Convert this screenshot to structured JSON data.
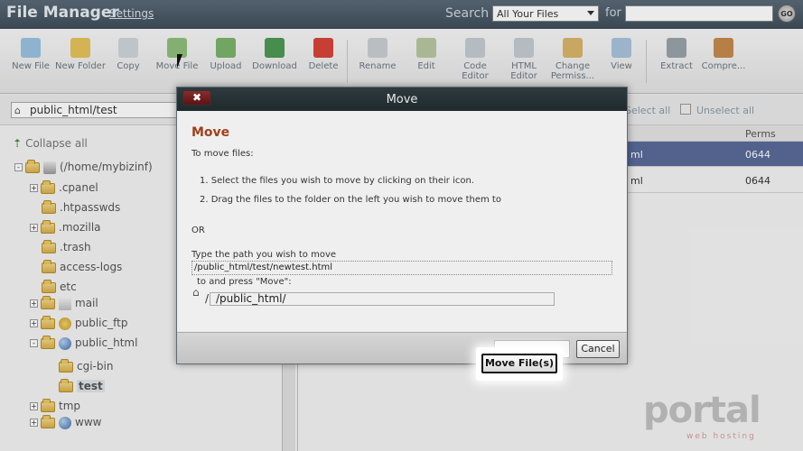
{
  "header": {
    "title": "File Manager",
    "settings_label": "Settings",
    "search_label": "Search",
    "search_scope": "All Your Files",
    "for_label": "for",
    "search_value": "",
    "go_label": "GO"
  },
  "toolbar": {
    "tools": [
      {
        "label": "New File",
        "icon": "new-file-icon",
        "color": "#9bc3e0"
      },
      {
        "label": "New Folder",
        "icon": "new-folder-icon",
        "color": "#e6c35a"
      },
      {
        "label": "Copy",
        "icon": "copy-icon",
        "color": "#cfd6dc"
      },
      {
        "label": "Move File",
        "icon": "move-file-icon",
        "color": "#8fbf7a"
      },
      {
        "label": "Upload",
        "icon": "upload-icon",
        "color": "#7ab36b"
      },
      {
        "label": "Download",
        "icon": "download-icon",
        "color": "#4d9a55"
      },
      {
        "label": "Delete",
        "icon": "delete-icon",
        "color": "#d8443a"
      },
      {
        "label": "Rename",
        "icon": "rename-icon",
        "color": "#c9cfd4"
      },
      {
        "label": "Edit",
        "icon": "edit-icon",
        "color": "#b9c7a2"
      },
      {
        "label": "Code Editor",
        "icon": "code-editor-icon",
        "color": "#c4ccd3"
      },
      {
        "label": "HTML Editor",
        "icon": "html-editor-icon",
        "color": "#c4ccd3"
      },
      {
        "label": "Change Permiss...",
        "icon": "key-icon",
        "color": "#d9b66a"
      },
      {
        "label": "View",
        "icon": "view-icon",
        "color": "#a9c4dc"
      },
      {
        "label": "Extract",
        "icon": "extract-icon",
        "color": "#9aa3aa"
      },
      {
        "label": "Compre...",
        "icon": "compress-icon",
        "color": "#c68a4b"
      }
    ]
  },
  "pathbar": {
    "path": "public_html/test"
  },
  "sidebar": {
    "collapse_label": "Collapse all",
    "tree": [
      {
        "label": "(/home/mybizinf)",
        "type": "home"
      },
      {
        "label": ".cpanel",
        "type": "folder"
      },
      {
        "label": ".htpasswds",
        "type": "folder"
      },
      {
        "label": ".mozilla",
        "type": "folder"
      },
      {
        "label": ".trash",
        "type": "folder"
      },
      {
        "label": "access-logs",
        "type": "folder"
      },
      {
        "label": "etc",
        "type": "folder"
      },
      {
        "label": "mail",
        "type": "mail"
      },
      {
        "label": "public_ftp",
        "type": "ftp"
      },
      {
        "label": "public_html",
        "type": "globe"
      },
      {
        "label": "cgi-bin",
        "type": "folder"
      },
      {
        "label": "test",
        "type": "folder-selected"
      },
      {
        "label": "tmp",
        "type": "folder"
      },
      {
        "label": "www",
        "type": "globe"
      }
    ]
  },
  "filepanel": {
    "select_all": "Select all",
    "unselect_all": "Unselect all",
    "perms_header": "Perms",
    "rows": [
      {
        "name": "ml",
        "perms": "0644",
        "selected": true
      },
      {
        "name": "ml",
        "perms": "0644",
        "selected": false
      }
    ]
  },
  "modal": {
    "title": "Move",
    "close_label": "✖",
    "heading": "Move",
    "intro": "To move files:",
    "step1": "1.  Select the files you wish to move by clicking on their icon.",
    "step2": "2.  Drag the files to the folder on the left you wish to move them to",
    "or_label": "OR",
    "type_path_label": "Type the path you wish to move",
    "source_path": "/public_html/test/newtest.html",
    "press_move_label": "to and press \"Move\":",
    "dest_slash": "/",
    "dest_path": "/public_html/",
    "move_button": "Move File(s)",
    "cancel_button": "Cancel"
  },
  "watermark": {
    "brand": "portal",
    "sub": "web hosting"
  }
}
